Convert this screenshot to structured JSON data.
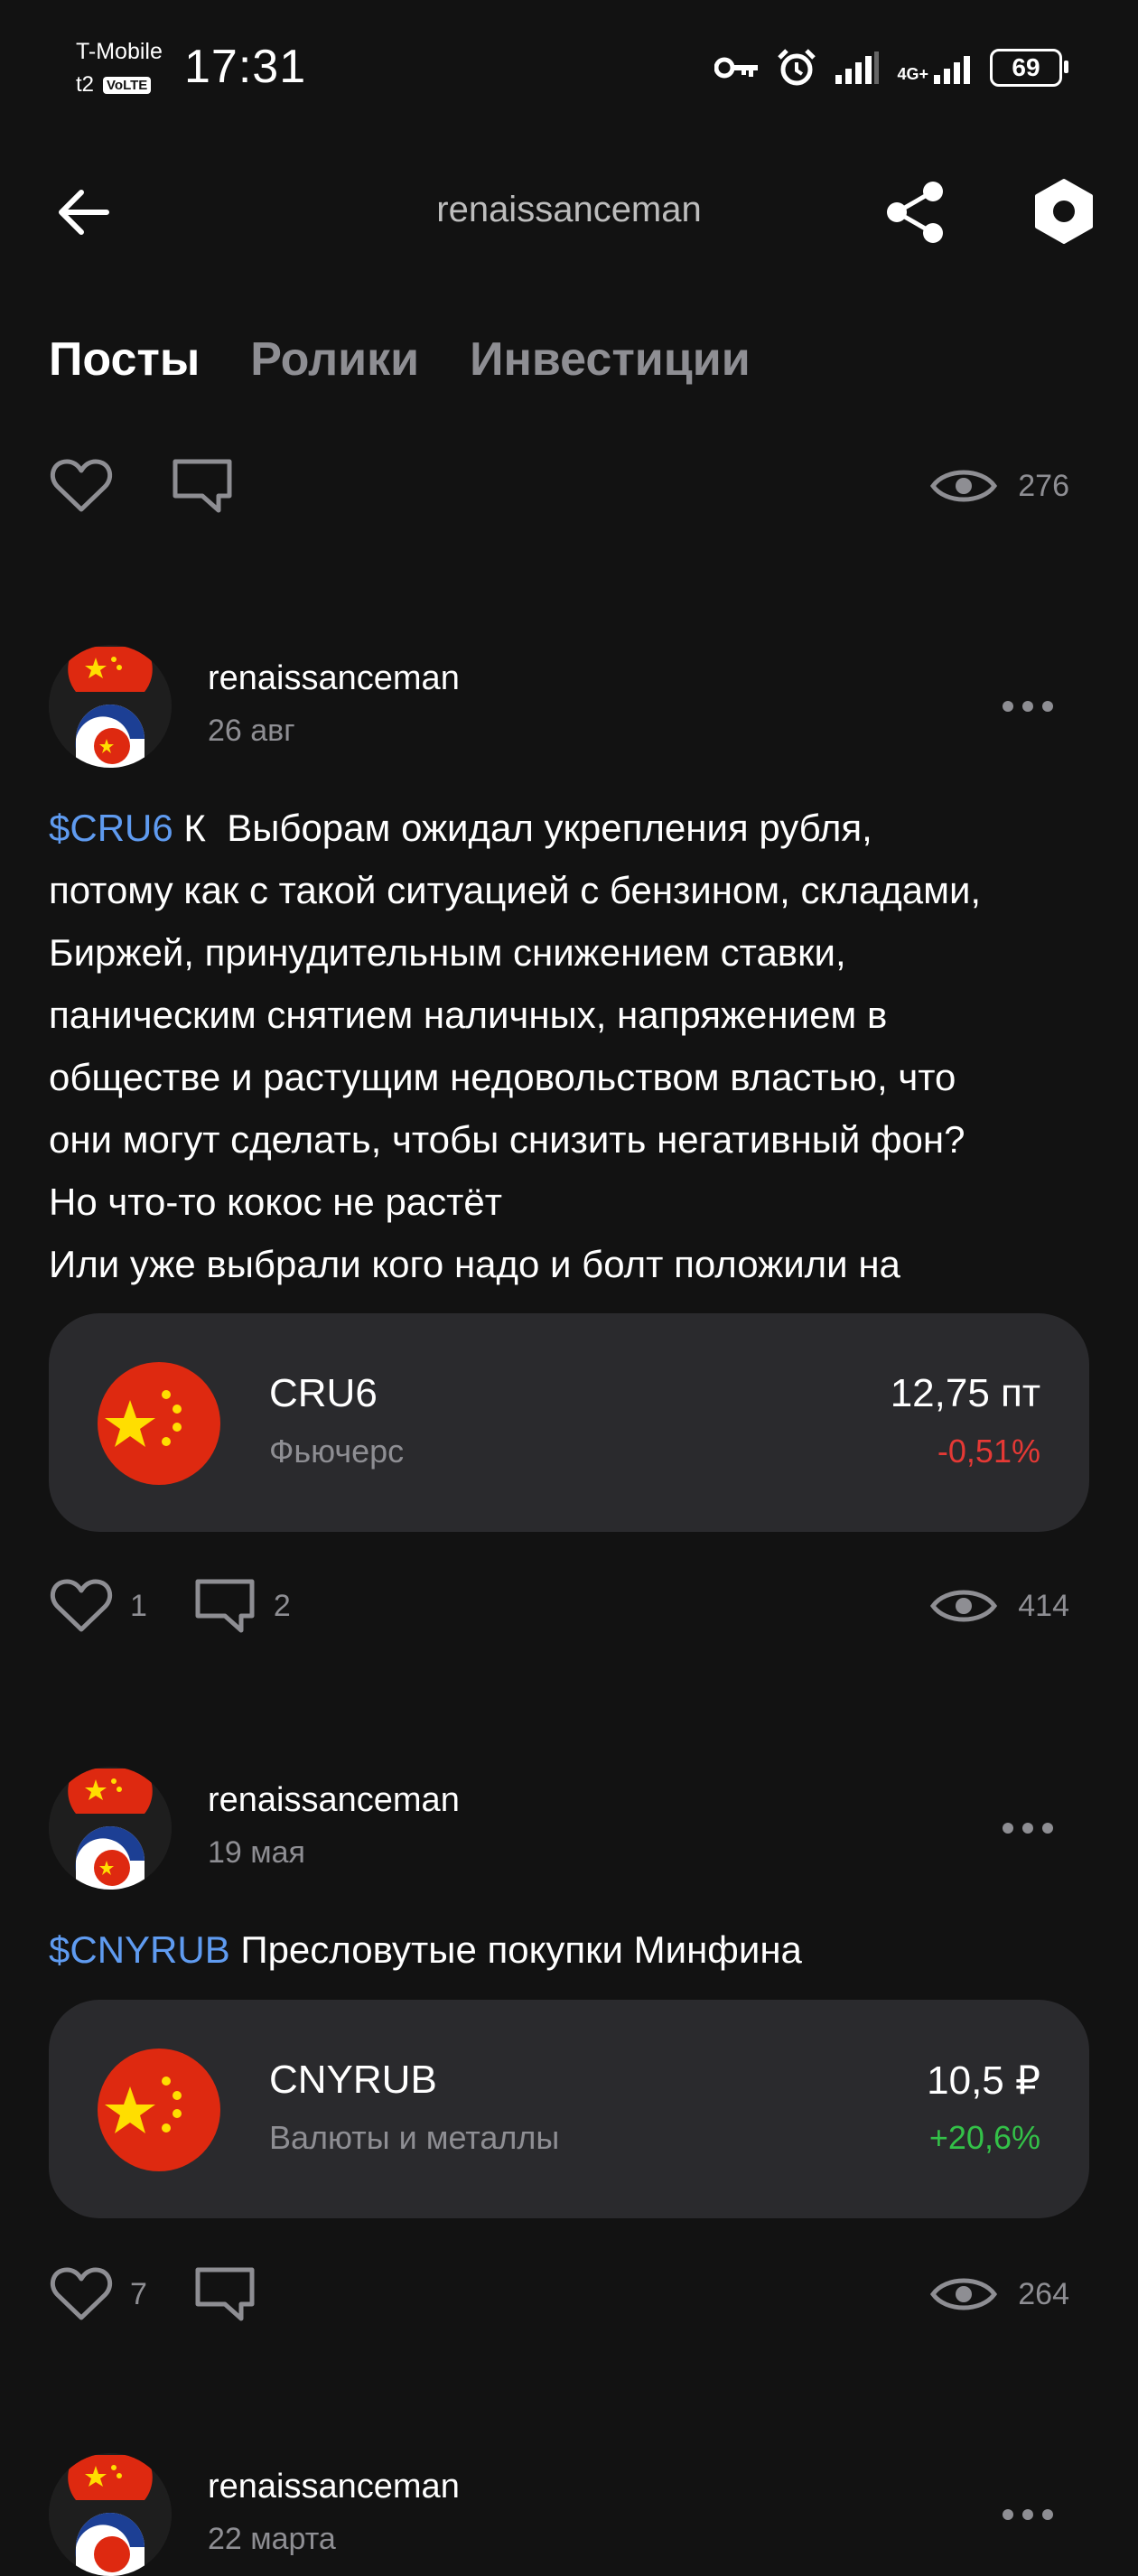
{
  "status_bar": {
    "carrier": "T-Mobile",
    "carrier2": "t2",
    "volte": "VoLTE",
    "time": "17:31",
    "network": "4G+",
    "battery": "69"
  },
  "header": {
    "title": "renaissanceman"
  },
  "tabs": [
    {
      "label": "Посты",
      "active": true
    },
    {
      "label": "Ролики",
      "active": false
    },
    {
      "label": "Инвестиции",
      "active": false
    }
  ],
  "top_actions": {
    "likes": "",
    "comments": "",
    "views": "276"
  },
  "posts": [
    {
      "author": "renaissanceman",
      "date": "26 авг",
      "ticker": "$CRU6",
      "text_lines": [
        " К  Выборам ожидал укрепления рубля,",
        "потому как с такой ситуацией с бензином, складами,",
        "Биржей, принудительным снижением ставки,",
        "паническим снятием наличных, напряжением в",
        "обществе и растущим недовольством властью, что",
        "они могут сделать, чтобы снизить негативный фон?",
        "Но что-то кокос не растёт",
        "Или уже выбрали кого надо и болт положили на"
      ],
      "instrument": {
        "name": "CRU6",
        "type": "Фьючерс",
        "price": "12,75 пт",
        "change": "-0,51%",
        "change_color": "#e53935"
      },
      "likes": "1",
      "comments": "2",
      "views": "414"
    },
    {
      "author": "renaissanceman",
      "date": "19 мая",
      "ticker": "$CNYRUB",
      "text_lines": [
        " Пресловутые покупки Минфина"
      ],
      "instrument": {
        "name": "CNYRUB",
        "type": "Валюты и металлы",
        "price": "10,5 ₽",
        "change": "+20,6%",
        "change_color": "#33c148"
      },
      "likes": "7",
      "comments": "",
      "views": "264"
    },
    {
      "author": "renaissanceman",
      "date": "22 марта"
    }
  ],
  "colors": {
    "background": "#121212",
    "card": "#2a2a2d",
    "ticker": "#5f9bf0",
    "muted": "#8e8e93"
  }
}
